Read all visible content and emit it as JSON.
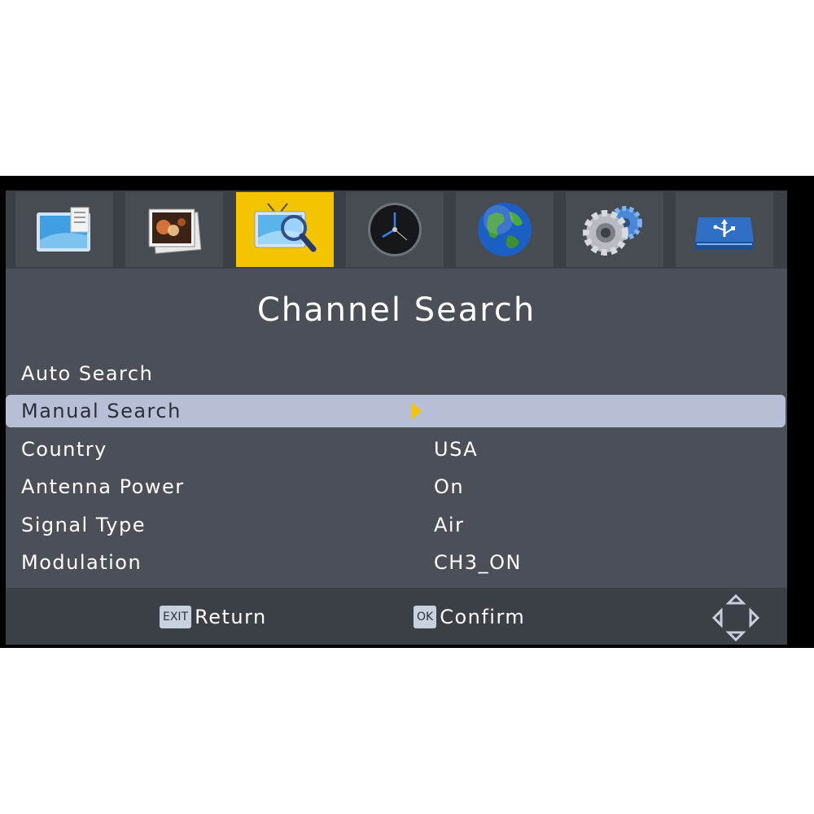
{
  "menu": {
    "title": "Channel Search",
    "tabs": [
      {
        "name": "program",
        "icon": "tv-list-icon",
        "selected": false
      },
      {
        "name": "picture",
        "icon": "photo-icon",
        "selected": false
      },
      {
        "name": "channel-search",
        "icon": "tv-search-icon",
        "selected": true
      },
      {
        "name": "time",
        "icon": "clock-icon",
        "selected": false
      },
      {
        "name": "language",
        "icon": "globe-icon",
        "selected": false
      },
      {
        "name": "system",
        "icon": "gears-icon",
        "selected": false
      },
      {
        "name": "usb",
        "icon": "usb-drive-icon",
        "selected": false
      }
    ],
    "items": [
      {
        "label": "Auto Search",
        "value": ""
      },
      {
        "label": "Manual Search",
        "value": ""
      },
      {
        "label": "Country",
        "value": "USA"
      },
      {
        "label": "Antenna Power",
        "value": "On"
      },
      {
        "label": "Signal Type",
        "value": "Air"
      },
      {
        "label": "Modulation",
        "value": "CH3_ON"
      }
    ],
    "highlighted_item": "Manual Search"
  },
  "footer": {
    "exit_key": "EXIT",
    "exit_label": "Return",
    "ok_key": "OK",
    "ok_label": "Confirm"
  },
  "colors": {
    "accent": "#f5c400",
    "panel": "#4b4f57",
    "bar": "#3b3f46",
    "highlight": "#b7bfd6"
  }
}
